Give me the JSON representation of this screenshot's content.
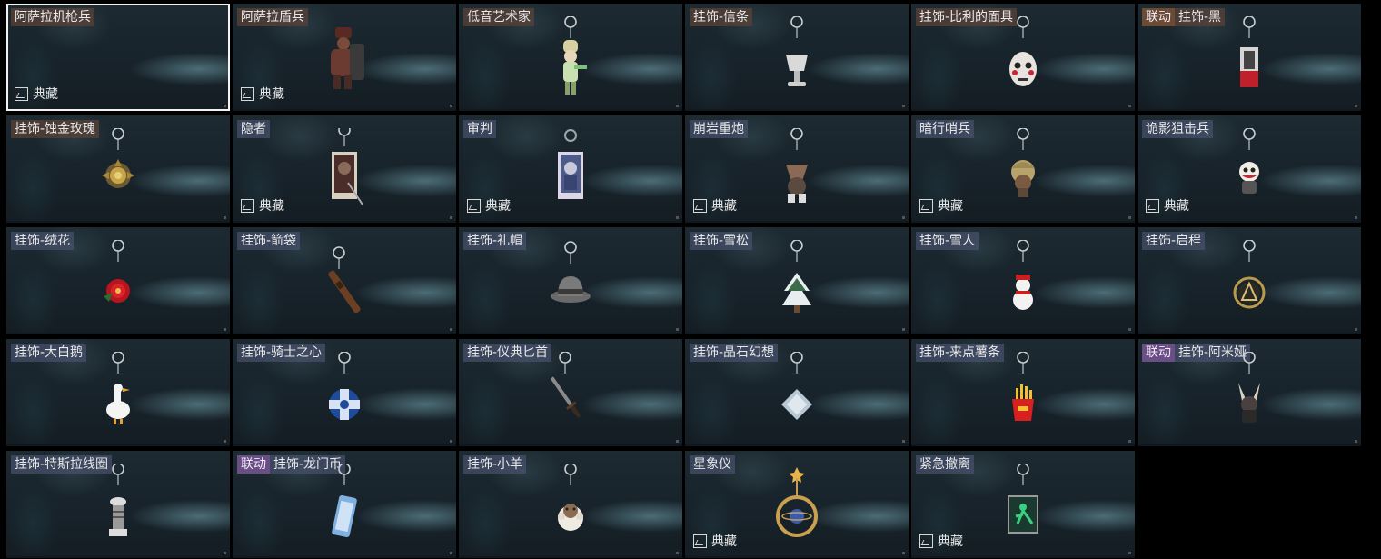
{
  "collection_label": "典藏",
  "cards": [
    {
      "name": "阿萨拉机枪兵",
      "collab": "",
      "collection": true,
      "selected": true,
      "icon": "empty",
      "style": "b"
    },
    {
      "name": "阿萨拉盾兵",
      "collab": "",
      "collection": true,
      "icon": "figure-soldier",
      "style": "b"
    },
    {
      "name": "低音艺术家",
      "collab": "",
      "collection": false,
      "icon": "figure-artist",
      "style": "b"
    },
    {
      "name": "挂饰-信条",
      "collab": "",
      "collection": false,
      "icon": "charm-cup",
      "style": "b"
    },
    {
      "name": "挂饰-比利的面具",
      "collab": "",
      "collection": false,
      "icon": "charm-mask",
      "style": "b"
    },
    {
      "name": "挂饰-黑",
      "collab": "联动",
      "collab_style": "brown",
      "collection": false,
      "icon": "charm-card-black",
      "style": "b"
    },
    {
      "name": "挂饰-蚀金玫瑰",
      "collab": "",
      "collection": false,
      "icon": "charm-gold-rose",
      "style": "b"
    },
    {
      "name": "隐者",
      "collab": "",
      "collection": true,
      "icon": "card-hermit",
      "style": "s"
    },
    {
      "name": "审判",
      "collab": "",
      "collection": true,
      "icon": "card-judgement",
      "style": "s"
    },
    {
      "name": "崩岩重炮",
      "collab": "",
      "collection": true,
      "icon": "figure-cannon",
      "style": "s"
    },
    {
      "name": "暗行哨兵",
      "collab": "",
      "collection": true,
      "icon": "figure-sentinel",
      "style": "s"
    },
    {
      "name": "诡影狙击兵",
      "collab": "",
      "collection": true,
      "icon": "figure-sniper",
      "style": "s"
    },
    {
      "name": "挂饰-绒花",
      "collab": "",
      "collection": false,
      "icon": "charm-red-flower",
      "style": "s"
    },
    {
      "name": "挂饰-箭袋",
      "collab": "",
      "collection": false,
      "icon": "charm-quiver",
      "style": "s"
    },
    {
      "name": "挂饰-礼帽",
      "collab": "",
      "collection": false,
      "icon": "charm-hat",
      "style": "s"
    },
    {
      "name": "挂饰-雪松",
      "collab": "",
      "collection": false,
      "icon": "charm-tree",
      "style": "s"
    },
    {
      "name": "挂饰-雪人",
      "collab": "",
      "collection": false,
      "icon": "charm-snowman",
      "style": "s"
    },
    {
      "name": "挂饰-启程",
      "collab": "",
      "collection": false,
      "icon": "charm-medallion",
      "style": "s"
    },
    {
      "name": "挂饰-大白鹅",
      "collab": "",
      "collection": false,
      "icon": "charm-goose",
      "style": "s"
    },
    {
      "name": "挂饰-骑士之心",
      "collab": "",
      "collection": false,
      "icon": "charm-blue-cross",
      "style": "s"
    },
    {
      "name": "挂饰-仪典匕首",
      "collab": "",
      "collection": false,
      "icon": "charm-dagger",
      "style": "s"
    },
    {
      "name": "挂饰-晶石幻想",
      "collab": "",
      "collection": false,
      "icon": "charm-crystal",
      "style": "s"
    },
    {
      "name": "挂饰-来点薯条",
      "collab": "",
      "collection": false,
      "icon": "charm-fries",
      "style": "s"
    },
    {
      "name": "挂饰-阿米娅",
      "collab": "联动",
      "collab_style": "purple",
      "collection": false,
      "icon": "charm-amiya",
      "style": "s"
    },
    {
      "name": "挂饰-特斯拉线圈",
      "collab": "",
      "collection": false,
      "icon": "charm-tesla-coil",
      "style": "s"
    },
    {
      "name": "挂饰-龙门币",
      "collab": "联动",
      "collab_style": "purple",
      "collection": false,
      "icon": "charm-coin-tag",
      "style": "s"
    },
    {
      "name": "挂饰-小羊",
      "collab": "",
      "collection": false,
      "icon": "charm-sheep",
      "style": "s"
    },
    {
      "name": "星象仪",
      "collab": "",
      "collection": true,
      "icon": "charm-astrolabe",
      "style": "s"
    },
    {
      "name": "紧急撤离",
      "collab": "",
      "collection": true,
      "icon": "charm-exit-sign",
      "style": "s"
    }
  ]
}
